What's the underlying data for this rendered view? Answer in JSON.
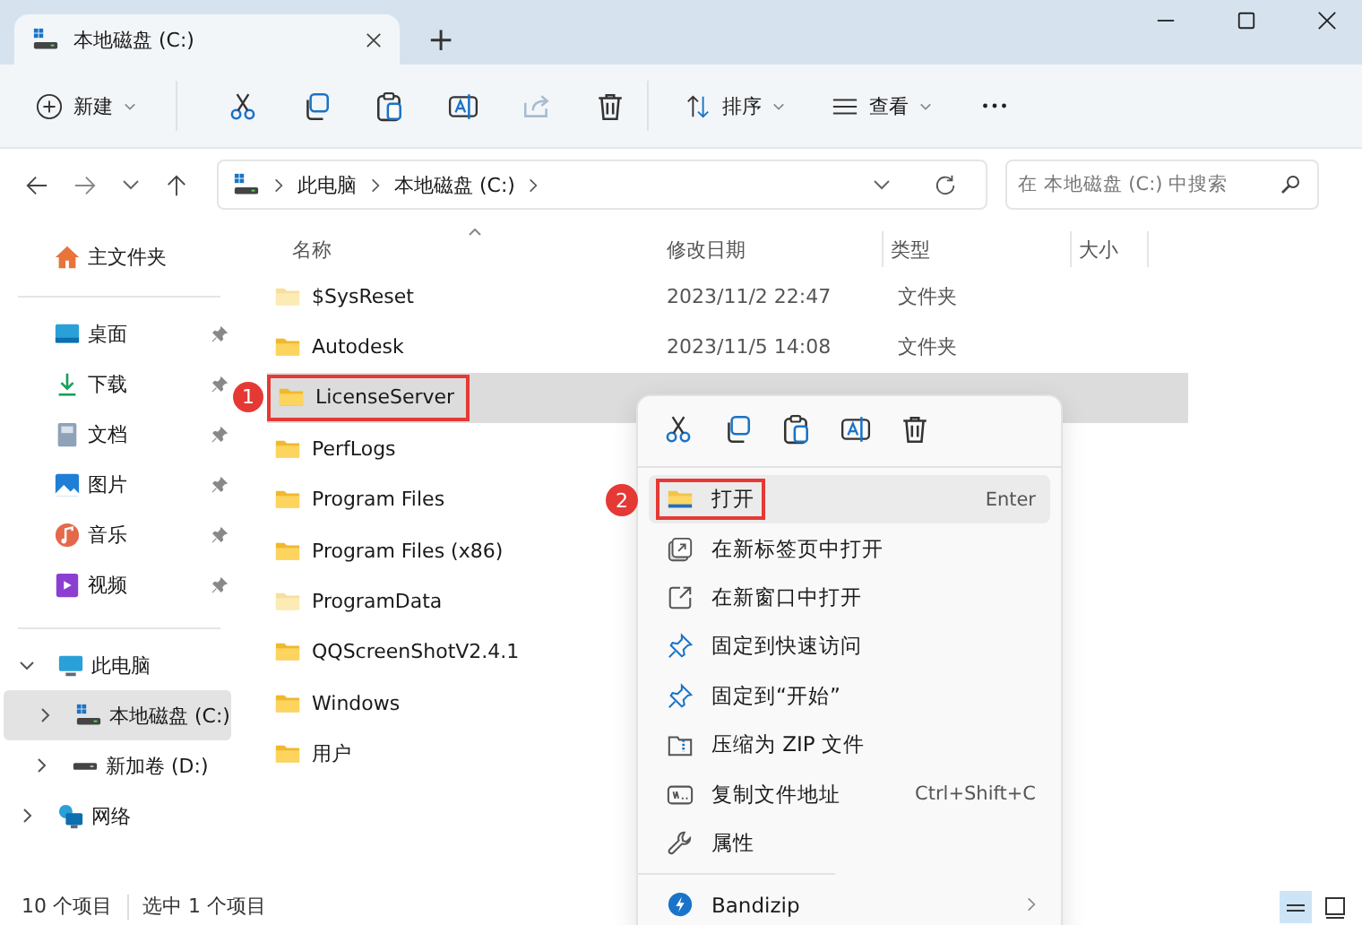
{
  "window": {
    "tab_title": "本地磁盘 (C:)",
    "new_tab": "+"
  },
  "toolbar": {
    "new": "新建",
    "sort": "排序",
    "view": "查看"
  },
  "address": {
    "path": [
      "此电脑",
      "本地磁盘 (C:)"
    ],
    "search_placeholder": "在 本地磁盘 (C:) 中搜索"
  },
  "sidebar": {
    "home": "主文件夹",
    "quick_access": [
      {
        "label": "桌面",
        "kind": "desktop"
      },
      {
        "label": "下载",
        "kind": "download"
      },
      {
        "label": "文档",
        "kind": "document"
      },
      {
        "label": "图片",
        "kind": "picture"
      },
      {
        "label": "音乐",
        "kind": "music"
      },
      {
        "label": "视频",
        "kind": "video"
      }
    ],
    "tree": [
      {
        "label": "此电脑",
        "kind": "pc",
        "expanded": true,
        "selected": false,
        "children": [
          {
            "label": "本地磁盘 (C:)",
            "kind": "system_drive",
            "expanded": false,
            "selected": true
          },
          {
            "label": "新加卷 (D:)",
            "kind": "drive",
            "expanded": false,
            "selected": false
          }
        ]
      },
      {
        "label": "网络",
        "kind": "network",
        "expanded": false,
        "selected": false
      }
    ]
  },
  "table": {
    "columns": [
      "名称",
      "修改日期",
      "类型",
      "大小"
    ],
    "rows": [
      {
        "name": "$SysReset",
        "date": "2023/11/2 22:47",
        "type": "文件夹",
        "hidden": true,
        "selected": false
      },
      {
        "name": "Autodesk",
        "date": "2023/11/5 14:08",
        "type": "文件夹",
        "hidden": false,
        "selected": false
      },
      {
        "name": "LicenseServer",
        "hidden": false,
        "selected": true,
        "callout": "1"
      },
      {
        "name": "PerfLogs",
        "hidden": false,
        "selected": false
      },
      {
        "name": "Program Files",
        "hidden": false,
        "selected": false
      },
      {
        "name": "Program Files (x86)",
        "hidden": false,
        "selected": false
      },
      {
        "name": "ProgramData",
        "hidden": true,
        "selected": false
      },
      {
        "name": "QQScreenShotV2.4.1",
        "hidden": false,
        "selected": false
      },
      {
        "name": "Windows",
        "hidden": false,
        "selected": false
      },
      {
        "name": "用户",
        "hidden": false,
        "selected": false
      }
    ]
  },
  "status_bar": {
    "count": "10 个项目",
    "selection": "选中 1 个项目"
  },
  "context_menu": {
    "actions": [
      {
        "kind": "cut"
      },
      {
        "kind": "copy"
      },
      {
        "kind": "paste"
      },
      {
        "kind": "rename"
      },
      {
        "kind": "delete"
      }
    ],
    "items": [
      {
        "label": "打开",
        "shortcut": "Enter",
        "kind": "folder",
        "highlighted": true,
        "callout": "2"
      },
      {
        "label": "在新标签页中打开",
        "kind": "newtab",
        "highlighted": false
      },
      {
        "label": "在新窗口中打开",
        "kind": "newwin",
        "highlighted": false
      },
      {
        "label": "固定到快速访问",
        "kind": "pin",
        "highlighted": false
      },
      {
        "label": "固定到“开始”",
        "kind": "pin",
        "highlighted": false
      },
      {
        "label": "压缩为 ZIP 文件",
        "kind": "zip",
        "highlighted": false
      },
      {
        "label": "复制文件地址",
        "shortcut": "Ctrl+Shift+C",
        "kind": "path",
        "highlighted": false
      },
      {
        "label": "属性",
        "kind": "wrench",
        "highlighted": false
      }
    ],
    "extensions": [
      {
        "label": "Bandizip",
        "kind": "bandizip"
      }
    ]
  }
}
